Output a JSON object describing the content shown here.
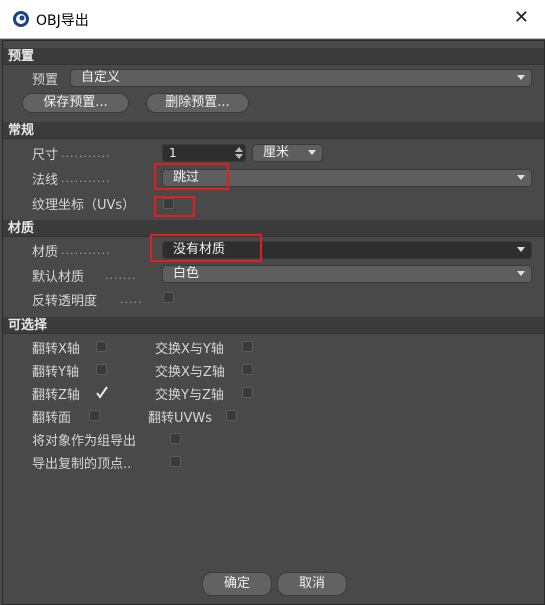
{
  "window": {
    "title": "OBJ导出",
    "close_glyph": "✕"
  },
  "sections": {
    "preset": "预置",
    "general": "常规",
    "material": "材质",
    "optional": "可选择"
  },
  "preset": {
    "label": "预置",
    "value": "自定义",
    "save_button": "保存预置...",
    "delete_button": "删除预置..."
  },
  "general": {
    "size_label": "尺寸",
    "size_value": "1",
    "size_unit": "厘米",
    "normals_label": "法线",
    "normals_value": "跳过",
    "uv_label": "纹理坐标（UVs）"
  },
  "material": {
    "material_label": "材质",
    "material_value": "没有材质",
    "default_label": "默认材质",
    "default_value": "白色",
    "invert_label": "反转透明度"
  },
  "optional": {
    "flip_x": "翻转X轴",
    "flip_y": "翻转Y轴",
    "flip_z": "翻转Z轴",
    "swap_xy": "交换X与Y轴",
    "swap_xz": "交换X与Z轴",
    "swap_yz": "交换Y与Z轴",
    "flip_face": "翻转面",
    "flip_uvw": "翻转UVWs",
    "export_group": "将对象作为组导出",
    "export_dup": "导出复制的顶点.."
  },
  "checked": {
    "flip_z": true
  },
  "footer": {
    "ok": "确定",
    "cancel": "取消"
  },
  "colors": {
    "highlight": "#e02020",
    "panel": "#494949",
    "header": "#3b3b3b"
  }
}
